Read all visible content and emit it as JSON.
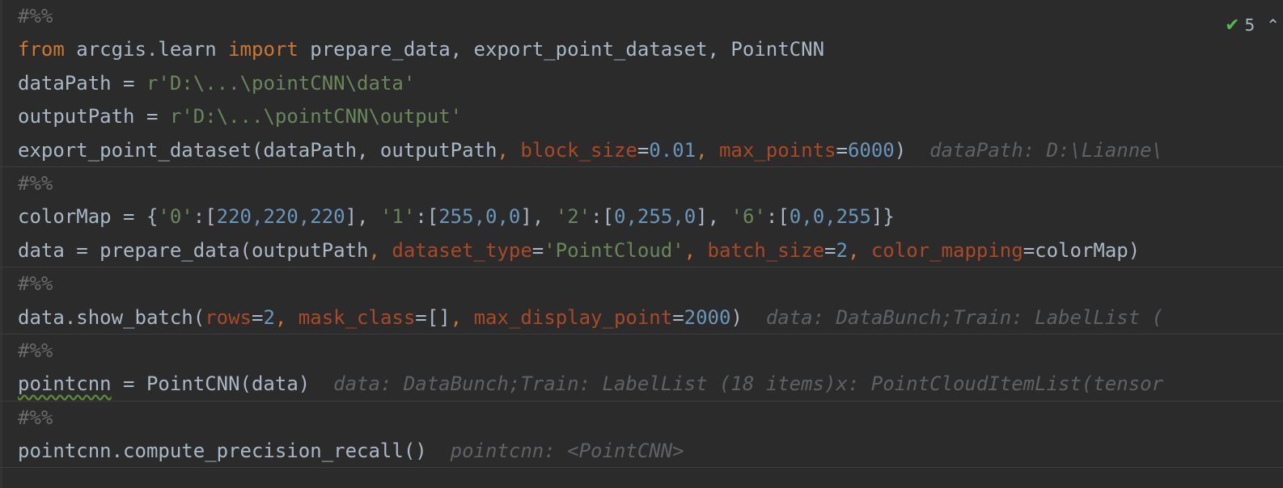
{
  "status": {
    "count": "5"
  },
  "code": {
    "cell1": "#%%",
    "l1": {
      "from": "from",
      "mod": " arcgis.learn ",
      "import": "import",
      "rest": " prepare_data, export_point_dataset, PointCNN"
    },
    "l2": {
      "a": "dataPath = ",
      "str": "r'D:\\...\\pointCNN\\data'"
    },
    "l3": {
      "a": "outputPath = ",
      "str": "r'D:\\...\\pointCNN\\output'"
    },
    "l4": {
      "a": "export_point_dataset(dataPath, outputPath",
      "c1": ", ",
      "p1": "block_size",
      "eq1": "=",
      "n1": "0.01",
      "c2": ", ",
      "p2": "max_points",
      "eq2": "=",
      "n2": "6000",
      "close": ")",
      "hint": "dataPath: D:\\Lianne\\"
    },
    "cell2": "#%%",
    "l5": {
      "a": "colorMap = {",
      "s0": "'0'",
      "c0": ":[",
      "n0": "220,220,220",
      "e0": "], ",
      "s1": "'1'",
      "c1": ":[",
      "n1": "255,0,0",
      "e1": "], ",
      "s2": "'2'",
      "c2": ":[",
      "n2": "0,255,0",
      "e2": "], ",
      "s6": "'6'",
      "c6": ":[",
      "n6": "0,0,255",
      "e6": "]}"
    },
    "l6": {
      "a": "data = prepare_data(outputPath",
      "c1": ", ",
      "p1": "dataset_type",
      "eq1": "=",
      "s1": "'PointCloud'",
      "c2": ", ",
      "p2": "batch_size",
      "eq2": "=",
      "n2": "2",
      "c3": ", ",
      "p3": "color_mapping",
      "eq3": "=",
      "v3": "colorMap)"
    },
    "cell3": "#%%",
    "l7": {
      "a": "data.show_batch(",
      "p1": "rows",
      "eq1": "=",
      "n1": "2",
      "c2": ", ",
      "p2": "mask_class",
      "eq2": "=[]",
      "c3": ", ",
      "p3": "max_display_point",
      "eq3": "=",
      "n3": "2000",
      "close": ")",
      "hint": "data: DataBunch;Train: LabelList ("
    },
    "cell4": "#%%",
    "l8": {
      "var": "pointcnn",
      "rest": " = PointCNN(data)",
      "hint": "data: DataBunch;Train: LabelList (18 items)x: PointCloudItemList(tensor"
    },
    "cell5": "#%%",
    "l9": {
      "a": "pointcnn.compute_precision_recall()",
      "hint": "pointcnn: <PointCNN>"
    }
  }
}
